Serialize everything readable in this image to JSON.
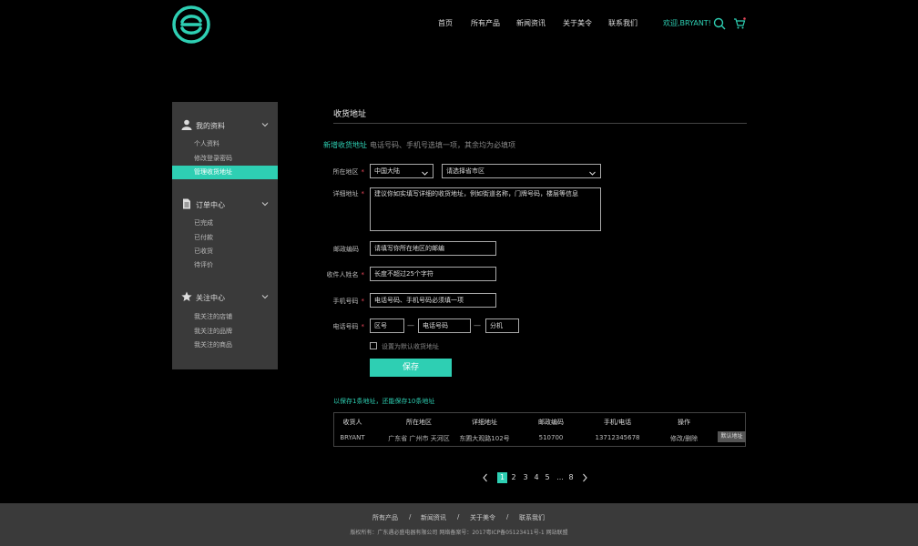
{
  "header": {
    "nav": [
      "首页",
      "所有产品",
      "新闻资讯",
      "关于美令",
      "联系我们"
    ],
    "welcome": "欢迎,BRYANT!",
    "icons": {
      "logo": "brand-logo-icon",
      "search": "search-icon",
      "cart": "cart-icon"
    },
    "accent_color": "#2ecfb3"
  },
  "sidebar": {
    "groups": [
      {
        "label": "我的资料",
        "icon": "user-icon",
        "items": [
          "个人资料",
          "修改登录密码",
          "管理收货地址"
        ],
        "active_index": 2
      },
      {
        "label": "订单中心",
        "icon": "document-icon",
        "items": [
          "已完成",
          "已付款",
          "已收货",
          "待评价"
        ]
      },
      {
        "label": "关注中心",
        "icon": "star-icon",
        "items": [
          "我关注的店铺",
          "我关注的品牌",
          "我关注的商品"
        ]
      }
    ]
  },
  "main": {
    "title": "收货地址",
    "add_label": "新增收货地址",
    "add_hint": "电话号码、手机号选填一项，其余均为必填项",
    "form": {
      "region_label": "所在地区",
      "region_country": "中国大陆",
      "region_city": "请选择省市区",
      "detail_label": "详细地址",
      "detail_placeholder": "建议你如实填写详细的收货地址，例如街道名称，门牌号码，楼层等信息",
      "zip_label": "邮政编码",
      "zip_placeholder": "请填写你所在地区的邮编",
      "name_label": "收件人姓名",
      "name_placeholder": "长度不超过25个字符",
      "mobile_label": "手机号码",
      "mobile_placeholder": "电话号码、手机号码必须填一项",
      "phone_label": "电话号码",
      "phone_area": "区号",
      "phone_number": "电话号码",
      "phone_ext": "分机",
      "dash": "—",
      "default_check_label": "设置为默认收货地址",
      "required_mark": "*",
      "save_label": "保存"
    },
    "saved_note": "以保存1条地址，还能保存10条地址",
    "table": {
      "headers": [
        "收货人",
        "所在地区",
        "详细地址",
        "邮政编码",
        "手机/电话",
        "操作"
      ],
      "rows": [
        {
          "name": "BRYANT",
          "region": "广东省 广州市 天河区",
          "address": "东圃大观路102号",
          "zip": "510700",
          "phone": "13712345678",
          "ops": "修改/删除",
          "default_label": "默认地址"
        }
      ]
    },
    "pagination": {
      "pages": [
        "1",
        "2",
        "3",
        "4",
        "5",
        "...",
        "8"
      ],
      "active": "1"
    }
  },
  "footer": {
    "links": [
      "所有产品",
      "新闻资讯",
      "关于美令",
      "联系我们"
    ],
    "separator": "/",
    "copyright": "版权所有：广东遇必盛电器有限公司  网络备案号：2017粤ICP备05123411号-1 网站联盟"
  }
}
